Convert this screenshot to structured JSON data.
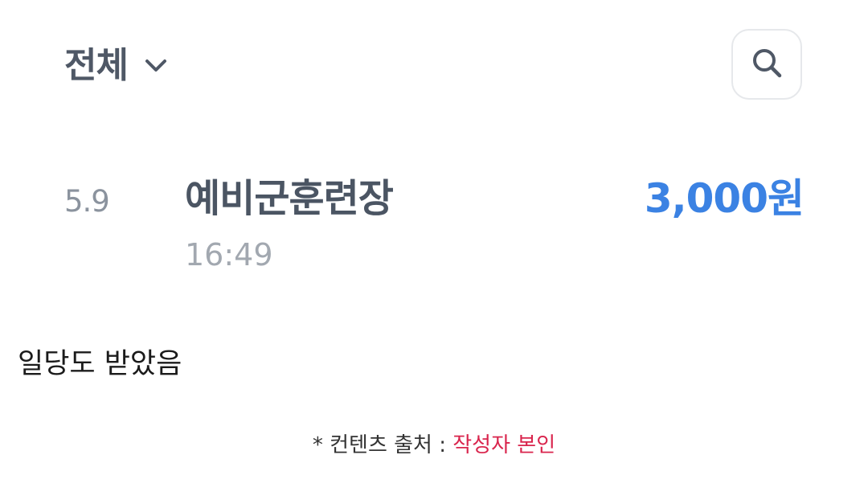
{
  "header": {
    "filter_label": "전체",
    "filter_icon": "chevron-down-icon",
    "search_icon": "search-icon"
  },
  "transaction": {
    "date": "5.9",
    "title": "예비군훈련장",
    "time": "16:49",
    "amount": "3,000원",
    "amount_color": "#3b82e3"
  },
  "caption": "일당도 받았음",
  "source": {
    "prefix": "* 컨텐츠 출처 : ",
    "author": "작성자 본인",
    "author_color": "#d9254d"
  }
}
